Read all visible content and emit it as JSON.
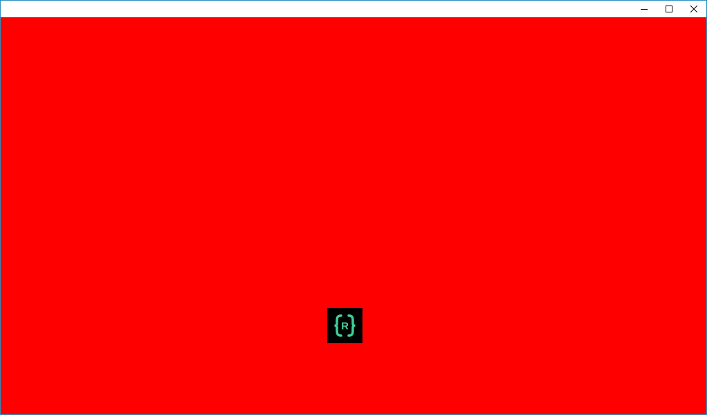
{
  "window": {
    "title": "",
    "content_background": "#ff0000",
    "border_color": "#2b8fbf"
  },
  "caption_buttons": {
    "minimize_icon": "minimize-icon",
    "maximize_icon": "maximize-icon",
    "close_icon": "close-icon"
  },
  "logo": {
    "icon": "braces-r-logo-icon",
    "letter": "R",
    "background": "#000000",
    "accent": "#3ecf9a"
  }
}
